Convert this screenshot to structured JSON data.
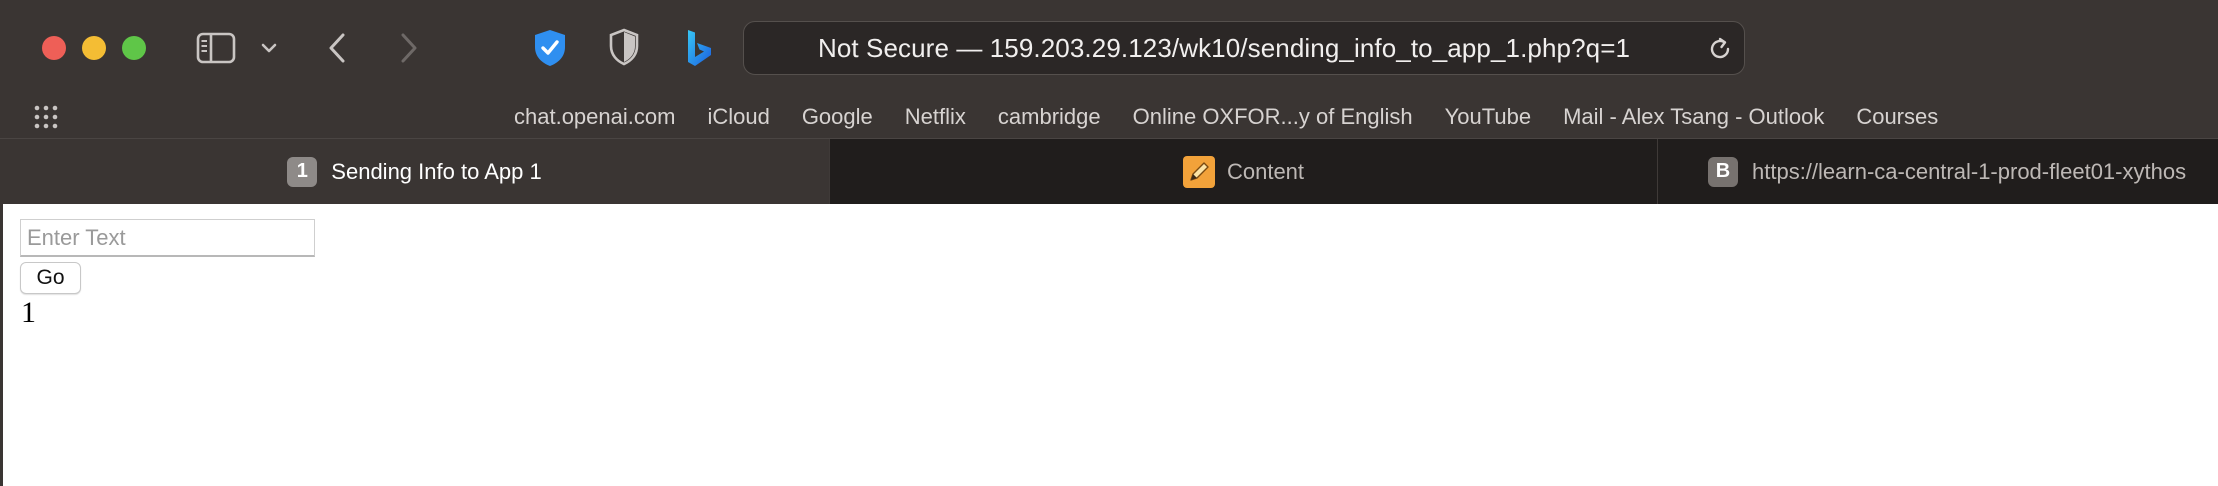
{
  "browser": {
    "address_bar": {
      "url_display": "Not Secure — 159.203.29.123/wk10/sending_info_to_app_1.php?q=1"
    },
    "favorites": [
      "chat.openai.com",
      "iCloud",
      "Google",
      "Netflix",
      "cambridge",
      "Online OXFOR...y of English",
      "YouTube",
      "Mail - Alex Tsang - Outlook",
      "Courses"
    ],
    "tabs": [
      {
        "badge": "1",
        "label": "Sending Info to App 1",
        "active": true
      },
      {
        "badge": "",
        "label": "Content",
        "active": false
      },
      {
        "badge": "B",
        "label": "https://learn-ca-central-1-prod-fleet01-xythos",
        "active": false
      }
    ]
  },
  "page": {
    "input": {
      "placeholder": "Enter Text",
      "value": ""
    },
    "go_label": "Go",
    "result": "1"
  },
  "colors": {
    "toolbar_bg": "#3a3533",
    "tabbar_bg": "#201d1c",
    "close": "#ee5f57",
    "minimize": "#f4bd34",
    "zoom": "#5fc648",
    "shield_blue": "#2f8ff0",
    "bing_blue": "#1b8ee8"
  },
  "icons": {
    "sidebar": "sidebar-icon",
    "back": "chevron-left-icon",
    "forward": "chevron-right-icon",
    "reload": "reload-icon",
    "favorites_grid": "grid-icon"
  }
}
